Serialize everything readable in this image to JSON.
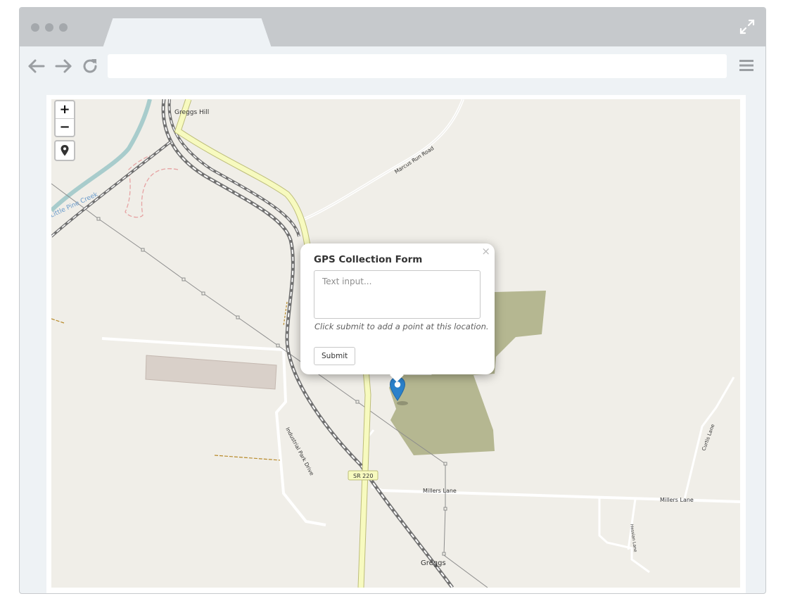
{
  "browser": {
    "address_bar": {
      "value": ""
    }
  },
  "map": {
    "labels": {
      "greggs_hill": "Greggs Hill",
      "marcus_run_road": "Marcus Run Road",
      "river": "Little Pine Creek",
      "industrial_park_drive": "Industrial Park Drive",
      "sr220": "SR 220",
      "millers_lane_1": "Millers Lane",
      "millers_lane_2": "Millers Lane",
      "curtis_lane": "Curtis Lane",
      "hessian_lane": "Hessian Lane",
      "greggs": "Greggs"
    },
    "controls": {
      "zoom_in": "+",
      "zoom_out": "−"
    },
    "popup": {
      "title": "GPS Collection Form",
      "close": "×",
      "textarea_placeholder": "Text input...",
      "help_text": "Click submit to add a point at this location.",
      "submit_label": "Submit"
    },
    "marker_color": "#2a81cb"
  }
}
